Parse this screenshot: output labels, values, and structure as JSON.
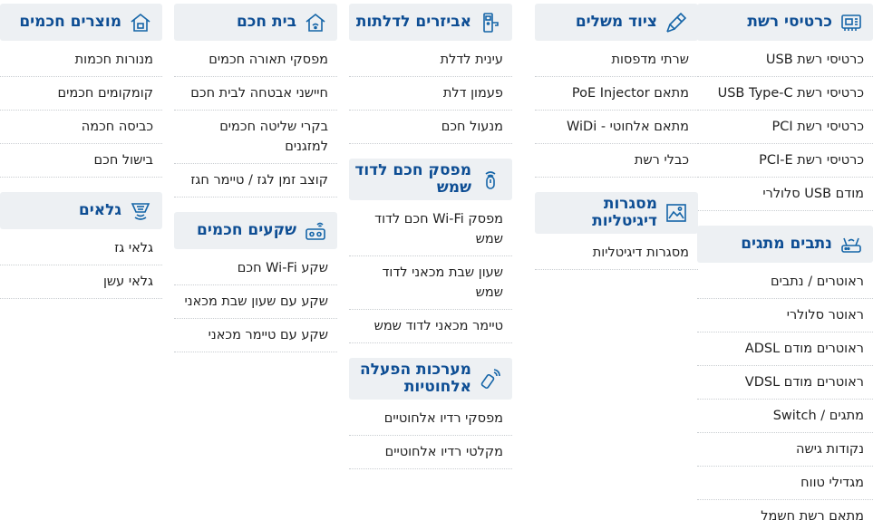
{
  "columns": [
    {
      "categories": [
        {
          "title": "כרטיסי רשת",
          "icon": "network-card-icon",
          "items": [
            "כרטיסי רשת USB",
            "כרטיסי רשת USB Type-C",
            "כרטיסי רשת PCI",
            "כרטיסי רשת PCI-E",
            "מודם USB סלולרי"
          ]
        },
        {
          "title": "נתבים מתגים",
          "icon": "router-icon",
          "items": [
            "ראוטרים / נתבים",
            "ראוטר סלולרי",
            "ראוטרים מודם ADSL",
            "ראוטרים מודם VDSL",
            "מתגים / Switch",
            "נקודות גישה",
            "מגדילי טווח",
            "מתאם רשת חשמל"
          ]
        }
      ]
    },
    {
      "categories": [
        {
          "title": "ציוד משלים",
          "icon": "tools-icon",
          "items": [
            "שרתי מדפסות",
            "מתאם PoE Injector",
            "מתאם אלחוטי - WiDi",
            "כבלי רשת"
          ]
        },
        {
          "title": "מסגרות דיגיטליות",
          "icon": "picture-frame-icon",
          "items": [
            "מסגרות דיגיטליות"
          ]
        }
      ]
    },
    {
      "categories": [
        {
          "title": "אביזרים לדלתות",
          "icon": "door-lock-icon",
          "items": [
            "עינית לדלת",
            "פעמון דלת",
            "מנעול חכם"
          ]
        },
        {
          "title": "מפסק חכם לדוד שמש",
          "icon": "water-heater-switch-icon",
          "items": [
            "מפסק Wi-Fi חכם לדוד שמש",
            "שעון שבת מכאני לדוד שמש",
            "טיימר מכאני לדוד שמש"
          ]
        },
        {
          "title": "מערכות הפעלה אלחוטיות",
          "icon": "remote-control-icon",
          "items": [
            "מפסקי רדיו אלחוטיים",
            "מקלטי רדיו אלחוטיים"
          ]
        }
      ]
    },
    {
      "categories": [
        {
          "title": "בית חכם",
          "icon": "smart-home-icon",
          "items": [
            "מפסקי תאורה חכמים",
            "חיישני אבטחה לבית חכם",
            "בקרי שליטה חכמים למזגנים",
            "קוצב זמן לגז / טיימר חגז"
          ]
        },
        {
          "title": "שקעים חכמים",
          "icon": "smart-plug-icon",
          "items": [
            "שקע Wi-Fi חכם",
            "שקע עם שעון שבת מכאני",
            "שקע עם טיימר מכאני"
          ]
        }
      ]
    },
    {
      "categories": [
        {
          "title": "מוצרים חכמים",
          "icon": "smart-products-icon",
          "items": [
            "מנורות חכמות",
            "קומקומים חכמים",
            "כביסה חכמה",
            "בישול חכם"
          ]
        },
        {
          "title": "גלאים",
          "icon": "detector-icon",
          "items": [
            "גלאי גז",
            "גלאי עשן"
          ]
        }
      ]
    }
  ]
}
